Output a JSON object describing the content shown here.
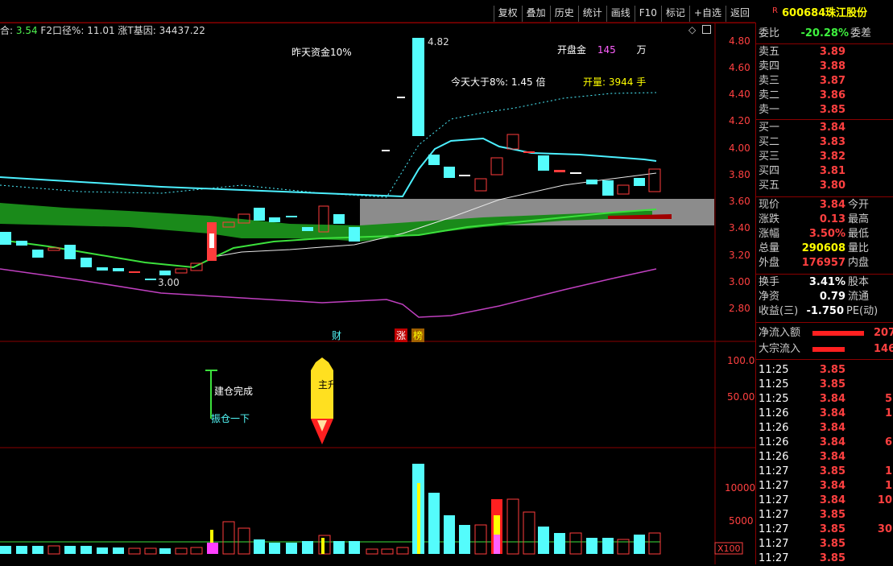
{
  "toolbar": {
    "buttons": [
      "复权",
      "叠加",
      "历史",
      "统计",
      "画线",
      "F10",
      "标记",
      "+自选",
      "返回"
    ]
  },
  "legend": {
    "item1_label": "合:",
    "item1_value": "3.54",
    "item2_label": "F2口径%:",
    "item2_value": "11.01",
    "item3_label": "涨T基因:",
    "item3_value": "34437.22"
  },
  "annotations": {
    "yesterday_funds": "昨天资金10%",
    "open_amount_label": "开盘金",
    "open_amount_value": "145",
    "open_amount_unit": "万",
    "today_over_label": "今天大于8%:",
    "today_over_value": "1.45",
    "today_over_unit": "倍",
    "open_vol_label": "开量:",
    "open_vol_value": "3944",
    "open_vol_unit": "手",
    "high_marker": "4.82",
    "low_marker": "3.00",
    "cai_tag": "财",
    "zhang_tag": "涨",
    "bang_tag": "榜",
    "build_done": "建仓完成",
    "shake": "振仓一下",
    "rocket_text": "主升浪",
    "x100": "X100"
  },
  "price_axis": [
    "4.80",
    "4.60",
    "4.40",
    "4.20",
    "4.00",
    "3.80",
    "3.60",
    "3.40",
    "3.20",
    "3.00",
    "2.80"
  ],
  "ind_axis": [
    "100.0",
    "50.00"
  ],
  "vol_axis": [
    "10000",
    "5000"
  ],
  "stock": {
    "flag": "R",
    "code": "600684",
    "name": "珠江股份"
  },
  "weibi": {
    "label": "委比",
    "value": "-20.28%",
    "label2": "委差"
  },
  "sells": [
    {
      "label": "卖五",
      "price": "3.89"
    },
    {
      "label": "卖四",
      "price": "3.88"
    },
    {
      "label": "卖三",
      "price": "3.87"
    },
    {
      "label": "卖二",
      "price": "3.86"
    },
    {
      "label": "卖一",
      "price": "3.85"
    }
  ],
  "buys": [
    {
      "label": "买一",
      "price": "3.84"
    },
    {
      "label": "买二",
      "price": "3.83"
    },
    {
      "label": "买三",
      "price": "3.82"
    },
    {
      "label": "买四",
      "price": "3.81"
    },
    {
      "label": "买五",
      "price": "3.80"
    }
  ],
  "quote": [
    {
      "label": "现价",
      "value": "3.84",
      "label2": "今开",
      "color": "red"
    },
    {
      "label": "涨跌",
      "value": "0.13",
      "label2": "最高",
      "color": "red"
    },
    {
      "label": "涨幅",
      "value": "3.50%",
      "label2": "最低",
      "color": "red"
    },
    {
      "label": "总量",
      "value": "290608",
      "label2": "量比",
      "color": "yellow"
    },
    {
      "label": "外盘",
      "value": "176957",
      "label2": "内盘",
      "color": "red"
    }
  ],
  "quote2": [
    {
      "label": "换手",
      "value": "3.41%",
      "label2": "股本",
      "color": "white"
    },
    {
      "label": "净资",
      "value": "0.79",
      "label2": "流通",
      "color": "white"
    },
    {
      "label": "收益(三)",
      "value": "-1.750",
      "label2": "PE(动)",
      "color": "white"
    }
  ],
  "flows": [
    {
      "label": "净流入额",
      "value": "207"
    },
    {
      "label": "大宗流入",
      "value": "146"
    }
  ],
  "ticks": [
    {
      "time": "11:25",
      "price": "3.85",
      "vol": ""
    },
    {
      "time": "11:25",
      "price": "3.85",
      "vol": ""
    },
    {
      "time": "11:25",
      "price": "3.84",
      "vol": "5"
    },
    {
      "time": "11:26",
      "price": "3.84",
      "vol": "1"
    },
    {
      "time": "11:26",
      "price": "3.84",
      "vol": ""
    },
    {
      "time": "11:26",
      "price": "3.84",
      "vol": "6"
    },
    {
      "time": "11:26",
      "price": "3.84",
      "vol": ""
    },
    {
      "time": "11:27",
      "price": "3.85",
      "vol": "1"
    },
    {
      "time": "11:27",
      "price": "3.84",
      "vol": "1"
    },
    {
      "time": "11:27",
      "price": "3.84",
      "vol": "10"
    },
    {
      "time": "11:27",
      "price": "3.85",
      "vol": ""
    },
    {
      "time": "11:27",
      "price": "3.85",
      "vol": "30"
    },
    {
      "time": "11:27",
      "price": "3.85",
      "vol": ""
    },
    {
      "time": "11:27",
      "price": "3.85",
      "vol": ""
    }
  ],
  "colors": {
    "up": "#ff3c3c",
    "down": "#54fcfc",
    "ma_cyan": "#4cf0ff",
    "ma_white": "#e8e8e8",
    "ma_green": "#3ce03c",
    "purple": "#c040c0",
    "frame": "#8a0000"
  }
}
